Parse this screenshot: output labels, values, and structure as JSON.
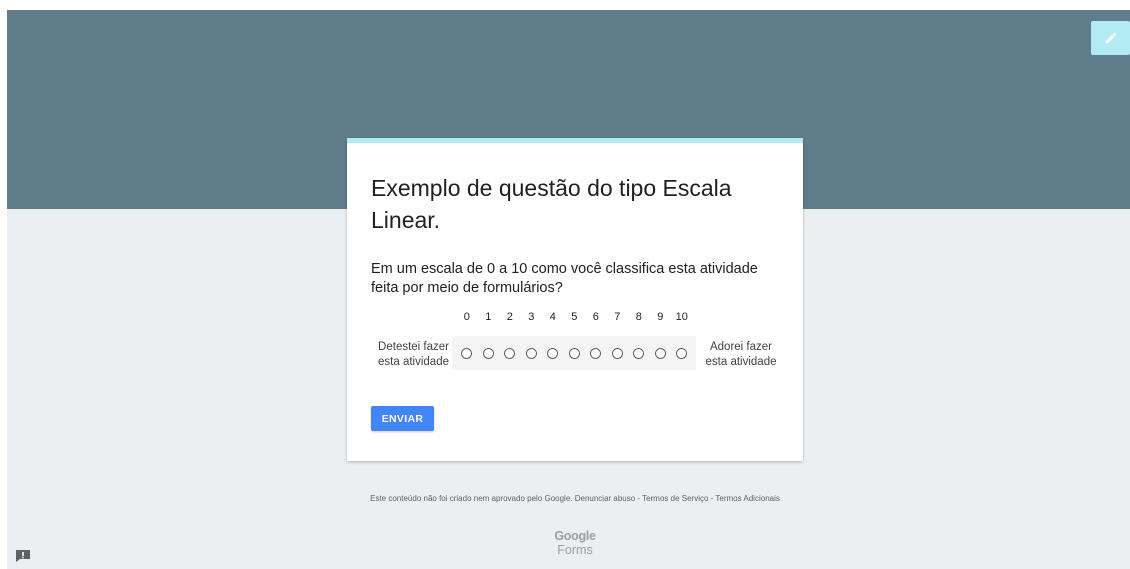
{
  "form": {
    "title": "Exemplo de questão do tipo Escala Linear.",
    "question": "Em um escala de 0 a 10 como você classifica esta atividade feita por meio de formulários?",
    "scale": {
      "numbers": [
        "0",
        "1",
        "2",
        "3",
        "4",
        "5",
        "6",
        "7",
        "8",
        "9",
        "10"
      ],
      "min_label": "Detestei fazer esta atividade",
      "max_label": "Adorei fazer esta atividade",
      "selected": null
    },
    "submit_label": "ENVIAR"
  },
  "footer": {
    "disclaimer": "Este conteúdo não foi criado nem aprovado pelo Google.",
    "report_abuse": "Denunciar abuso",
    "sep1": " - ",
    "terms": "Termos de Serviço",
    "sep2": " - ",
    "additional_terms": "Termos Adicionais",
    "logo_google": "Google",
    "logo_forms": "Forms"
  },
  "icons": {
    "edit": "pencil-icon",
    "report": "feedback-icon"
  },
  "colors": {
    "header": "#607d8b",
    "background": "#eceff1",
    "accent": "#b2ebf2",
    "button": "#4285f4"
  }
}
